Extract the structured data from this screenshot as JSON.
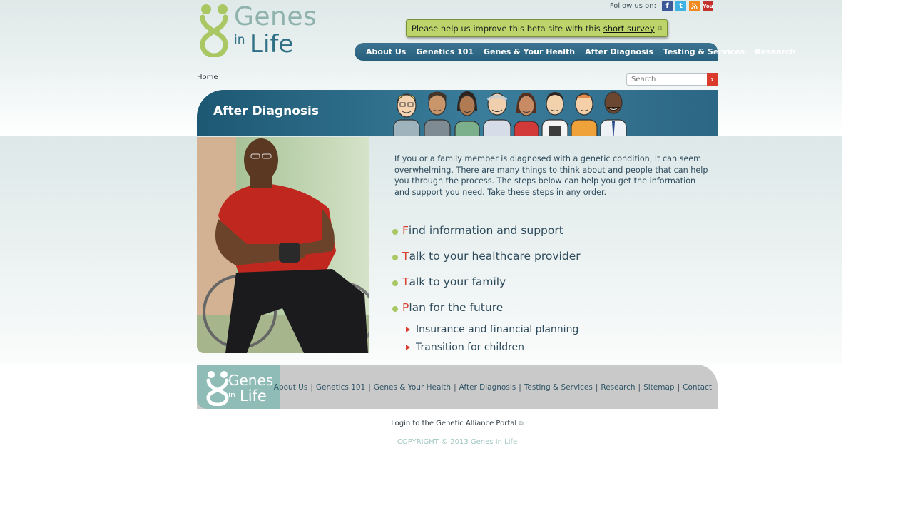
{
  "logo": {
    "genes": "Genes",
    "in": "in",
    "life": "Life"
  },
  "follow": {
    "label": "Follow us on:",
    "icons": [
      "facebook-icon",
      "twitter-icon",
      "rss-icon",
      "youtube-icon"
    ],
    "youtube_text": "You"
  },
  "survey": {
    "text": "Please help us improve this beta site with this",
    "link": "short survey"
  },
  "nav": {
    "items": [
      {
        "label": "About Us"
      },
      {
        "label": "Genetics 101"
      },
      {
        "label": "Genes & Your Health"
      },
      {
        "label": "After Diagnosis"
      },
      {
        "label": "Testing & Services"
      },
      {
        "label": "Research"
      }
    ]
  },
  "breadcrumb": {
    "home": "Home"
  },
  "search": {
    "placeholder": "Search"
  },
  "banner": {
    "title": "After Diagnosis"
  },
  "intro": "If you or a family member is diagnosed with a genetic condition, it can seem overwhelming. There are many things to think about and people that can help you through the process. The steps below can help you get the information and support you need. Take these steps in any order.",
  "steps": [
    {
      "first": "F",
      "rest": "ind information and support"
    },
    {
      "first": "T",
      "rest": "alk to your healthcare provider"
    },
    {
      "first": "T",
      "rest": "alk to your family"
    },
    {
      "first": "P",
      "rest": "lan for the future"
    }
  ],
  "substeps": [
    {
      "label": "Insurance and financial planning"
    },
    {
      "label": "Transition for children"
    }
  ],
  "footer": {
    "links": [
      {
        "label": "About Us"
      },
      {
        "label": "Genetics 101"
      },
      {
        "label": "Genes & Your Health"
      },
      {
        "label": "After Diagnosis"
      },
      {
        "label": "Testing & Services"
      },
      {
        "label": "Research"
      },
      {
        "label": "Sitemap"
      },
      {
        "label": "Contact"
      }
    ],
    "separator": "|",
    "portal": "Login to the Genetic Alliance Portal",
    "copyright": "COPYRIGHT © 2013 Genes In Life"
  },
  "colors": {
    "nav_blue": "#27607c",
    "accent_red": "#d9402f",
    "accent_green": "#a9c864",
    "survey_green": "#bcd46a"
  }
}
